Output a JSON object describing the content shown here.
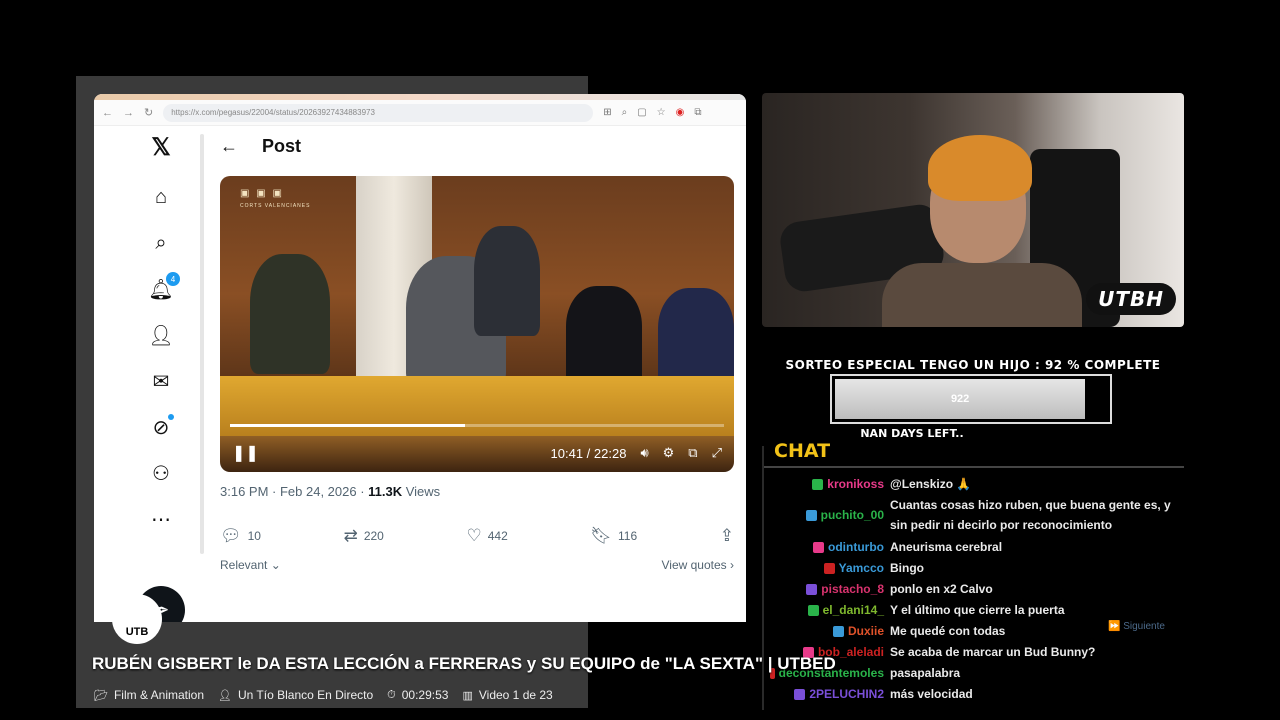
{
  "browser": {
    "url": "https://x.com/pegasus/22004/status/20263927434883973",
    "nav_back": "←",
    "nav_forward": "→",
    "nav_reload": "↻",
    "notif_badge": "4"
  },
  "post": {
    "back_icon": "←",
    "title": "Post",
    "video": {
      "crest_text": "CORTS VALENCIANES",
      "time": "10:41 / 22:28",
      "progress": 0.476
    },
    "timestamp": "3:16 PM · Feb 24, 2026 · ",
    "views_count": "11.3K",
    "views_label": " Views",
    "replies": "10",
    "reposts": "220",
    "likes": "442",
    "bookmarks": "116",
    "sort_label": "Relevant",
    "view_quotes": "View quotes"
  },
  "cam": {
    "tag": "UTBH"
  },
  "goal": {
    "title": "SORTEO ESPECIAL TENGO UN HIJO :  92 % COMPLETE",
    "value": "922",
    "progress": 0.92,
    "sub": "NAN DAYS LEFT.."
  },
  "chat": {
    "header": "CHAT",
    "messages": [
      {
        "user": "kronikoss",
        "color": "#e83a8a",
        "text": "@Lenskizo 🙏"
      },
      {
        "user": "puchito_00",
        "color": "#2ab34a",
        "text": "Cuantas cosas hizo ruben, que buena gente es, y sin pedir ni decirlo por reconocimiento"
      },
      {
        "user": "odinturbo",
        "color": "#3a9ad8",
        "text": "Aneurisma cerebral"
      },
      {
        "user": "Yamcco",
        "color": "#3a9ad8",
        "text": "Bingo"
      },
      {
        "user": "pistacho_8",
        "color": "#d8336e",
        "text": "ponlo en x2 Calvo"
      },
      {
        "user": "el_dani14_",
        "color": "#7fb82e",
        "text": "Y el último que cierre la puerta"
      },
      {
        "user": "Duxiie",
        "color": "#e0522a",
        "text": "Me quedé con todas"
      },
      {
        "user": "bob_aleladi",
        "color": "#c22",
        "text": "Se acaba de marcar un Bud Bunny?"
      },
      {
        "user": "deconstantemoles",
        "color": "#2ab34a",
        "text": "pasapalabra"
      },
      {
        "user": "2PELUCHIN2",
        "color": "#7a4fd8",
        "text": "más velocidad"
      }
    ],
    "next_label": "⏩ Siguiente"
  },
  "overlay": {
    "logo_text": "UTB",
    "title": "RUBÉN GISBERT le DA ESTA LECCIÓN a FERRERAS y SU EQUIPO de \"LA SEXTA\" | UTBED",
    "category": "Film & Animation",
    "channel": "Un Tío Blanco En Directo",
    "duration": "00:29:53",
    "playlist": "Video 1 de 23"
  }
}
